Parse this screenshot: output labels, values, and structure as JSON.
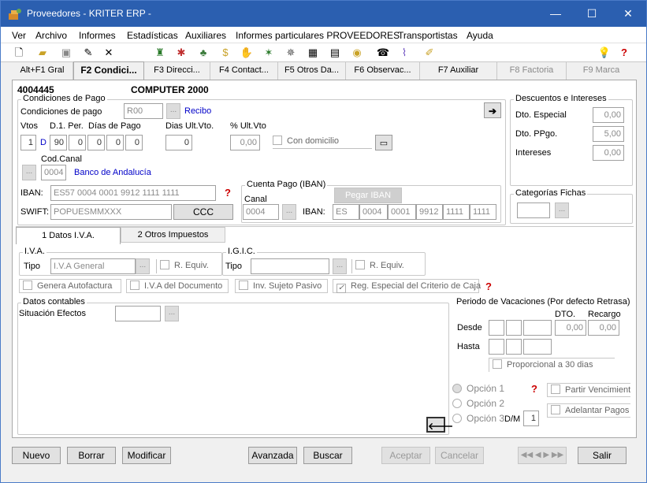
{
  "window": {
    "title": "Proveedores - KRITER ERP -",
    "minimize": "—",
    "maximize": "☐",
    "close": "✕"
  },
  "menu": [
    "Ver",
    "Archivo",
    "Informes",
    "Estadísticas",
    "Auxiliares",
    "Informes particulares PROVEEDORES",
    "Transportistas",
    "Ayuda"
  ],
  "toolbar": {
    "icons": [
      "new-doc",
      "open-folder",
      "save",
      "edit",
      "delete",
      "tool",
      "star",
      "tree",
      "dollar",
      "hand",
      "graph",
      "ribbon",
      "grid",
      "doc",
      "cd",
      "phone",
      "clip",
      "pen"
    ]
  },
  "tabs": [
    {
      "label": "Alt+F1 Gral",
      "active": false,
      "disabled": false
    },
    {
      "label": "F2 Condici...",
      "active": true,
      "disabled": false
    },
    {
      "label": "F3 Direcci...",
      "active": false,
      "disabled": false
    },
    {
      "label": "F4 Contact...",
      "active": false,
      "disabled": false
    },
    {
      "label": "F5 Otros Da...",
      "active": false,
      "disabled": false
    },
    {
      "label": "F6 Observac...",
      "active": false,
      "disabled": false
    },
    {
      "label": "F7 Auxiliar",
      "active": false,
      "disabled": false
    },
    {
      "label": "F8 Factoria",
      "active": false,
      "disabled": true
    },
    {
      "label": "F9 Marca",
      "active": false,
      "disabled": true
    }
  ],
  "header": {
    "code": "4004445",
    "name": "COMPUTER 2000"
  },
  "condiciones": {
    "group_title": "Condiciones de Pago",
    "label": "Condiciones de pago",
    "value": "R00",
    "desc": "Recibo",
    "vtos_label": "Vtos",
    "d1_label": "D.1. Per.",
    "dias_pago_label": "Días de Pago",
    "dias_ult_label": "Dias Ult.Vto.",
    "pct_ult_label": "% Ult.Vto",
    "vtos": "1",
    "d1_unit": "D",
    "d1": "90",
    "dias": [
      "0",
      "0",
      "0",
      "0"
    ],
    "dias_ult": "0",
    "pct_ult": "0,00",
    "con_domicilio": "Con domicilio",
    "cod_canal_label": "Cod.Canal",
    "cod_canal": "0004",
    "banco": "Banco de Andalucía",
    "iban_label": "IBAN:",
    "iban": "ES57 0004 0001 9912 1111 1111",
    "swift_label": "SWIFT:",
    "swift": "POPUESMMXXX",
    "ccc_button": "CCC"
  },
  "cuenta_pago": {
    "title": "Cuenta Pago (IBAN)",
    "canal_label": "Canal",
    "canal": "0004",
    "pegar": "Pegar IBAN",
    "iban_label": "IBAN:",
    "iban_parts": [
      "ES",
      "0004",
      "0001",
      "9912",
      "1111",
      "1111"
    ]
  },
  "descuentos": {
    "title": "Descuentos e Intereses",
    "dto_especial_label": "Dto. Especial",
    "dto_especial": "0,00",
    "dto_ppgo_label": "Dto. PPgo.",
    "dto_ppgo": "5,00",
    "intereses_label": "Intereses",
    "intereses": "0,00"
  },
  "categorias": {
    "title": "Categorías Fichas"
  },
  "subtabs": [
    {
      "label": "1 Datos I.V.A.",
      "active": true
    },
    {
      "label": "2 Otros Impuestos",
      "active": false
    }
  ],
  "iva": {
    "title": "I.V.A.",
    "tipo_label": "Tipo",
    "tipo": "I.V.A General",
    "requiv": "R. Equiv.",
    "igic_title": "I.G.I.C.",
    "igic_tipo_label": "Tipo",
    "igic_requiv": "R. Equiv.",
    "genera": "Genera Autofactura",
    "iva_doc": "I.V.A del Documento",
    "sujeto": "Inv. Sujeto Pasivo",
    "reg_especial": "Reg. Especial del Criterio de Caja"
  },
  "datos_contables": {
    "title": "Datos contables",
    "situacion_label": "Situación Efectos"
  },
  "vacaciones": {
    "title": "Periodo de Vacaciones (Por defecto Retrasa)",
    "dto_label": "DTO.",
    "recargo_label": "Recargo",
    "desde_label": "Desde",
    "hasta_label": "Hasta",
    "dto": "0,00",
    "recargo": "0,00",
    "proporcional": "Proporcional a 30 dias",
    "opcion1": "Opción 1",
    "opcion2": "Opción 2",
    "opcion3": "Opción 3",
    "dm_label": "D/M",
    "dm": "1",
    "partir": "Partir Vencimient",
    "adelantar": "Adelantar Pagos"
  },
  "buttons": {
    "nuevo": "Nuevo",
    "borrar": "Borrar",
    "modificar": "Modificar",
    "avanzada": "Avanzada",
    "buscar": "Buscar",
    "aceptar": "Aceptar",
    "cancelar": "Cancelar",
    "nav": "◀◀ ◀ ▶ ▶▶",
    "salir": "Salir"
  },
  "colors": {
    "titlebar": "#2b5fb0",
    "link_blue": "#0000c8",
    "help_red": "#cc0000"
  }
}
